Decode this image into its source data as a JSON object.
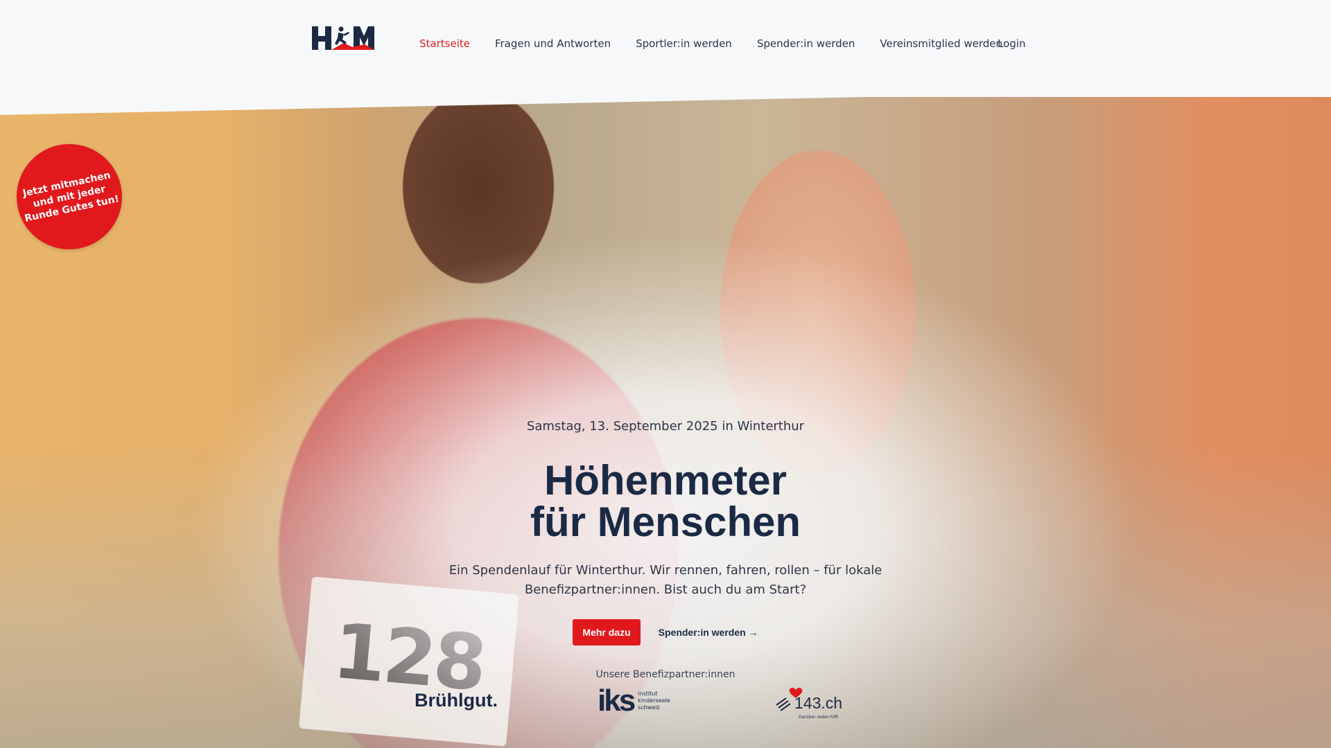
{
  "header": {
    "logo_text": "HfM",
    "nav": [
      {
        "label": "Startseite",
        "active": true
      },
      {
        "label": "Fragen und Antworten",
        "active": false
      },
      {
        "label": "Sportler:in werden",
        "active": false
      },
      {
        "label": "Spender:in werden",
        "active": false
      },
      {
        "label": "Vereinsmitglied werden",
        "active": false
      }
    ],
    "login": "Login"
  },
  "badge": {
    "line1": "Jetzt mitmachen",
    "line2": "und mit jeder",
    "line3": "Runde Gutes tun!"
  },
  "hero": {
    "date": "Samstag, 13. September 2025 in Winterthur",
    "title_line1": "Höhenmeter",
    "title_line2": "für Menschen",
    "lead_line1": "Ein Spendenlauf für Winterthur. Wir rennen, fahren, rollen – für lokale",
    "lead_line2": "Benefizpartner:innen. Bist auch du am Start?",
    "bib_number": "128",
    "primary_button": "Mehr dazu",
    "secondary_link": "Spender:in werden →"
  },
  "partners": {
    "label": "Unsere Benefizpartner:innen",
    "bruehlgut": "Brühlgut.",
    "iks_mark": "iks",
    "iks_sub1": "institut",
    "iks_sub2": "kinderseele",
    "iks_sub3": "schweiz",
    "p143": "143.ch",
    "p143_tag": "Darüber reden hilft"
  },
  "colors": {
    "accent": "#e1191d",
    "navy": "#1b2a44",
    "background": "#f7f8fa"
  }
}
